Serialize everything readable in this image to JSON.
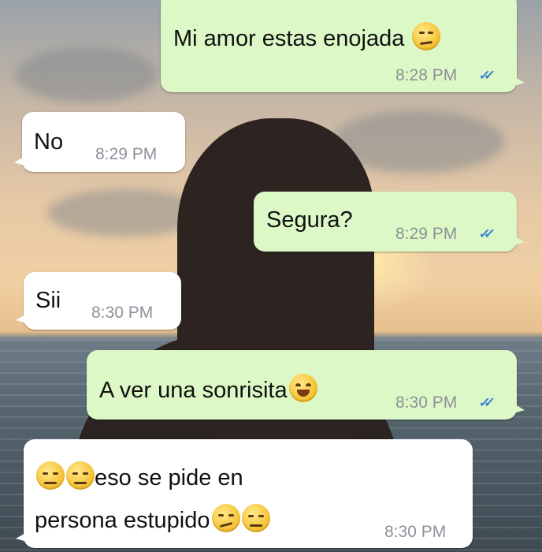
{
  "chat": {
    "messages": [
      {
        "direction": "outgoing",
        "text": "Mi amor estas enojada",
        "emojis": [
          "confused-face"
        ],
        "time": "8:28 PM",
        "ticks": "✓✓"
      },
      {
        "direction": "incoming",
        "text": "No",
        "time": "8:29 PM"
      },
      {
        "direction": "outgoing",
        "text": "Segura?",
        "time": "8:29 PM",
        "ticks": "✓✓"
      },
      {
        "direction": "incoming",
        "text": "Sii",
        "time": "8:30 PM"
      },
      {
        "direction": "outgoing",
        "text": "A ver una sonrisita",
        "emojis": [
          "grinning-squinting-face"
        ],
        "time": "8:30 PM",
        "ticks": "✓✓"
      },
      {
        "direction": "incoming",
        "text_line1": "eso se pide en",
        "text_line2": "persona estupido",
        "emojis_before": [
          "unamused-face",
          "unamused-face"
        ],
        "emojis_after": [
          "smirking-face",
          "unamused-face"
        ],
        "time": "8:30 PM"
      }
    ]
  },
  "colors": {
    "outgoing_bubble": "#dcf8c6",
    "incoming_bubble": "#ffffff",
    "read_ticks": "#3c7fd1",
    "timestamp": "#8d9199"
  }
}
